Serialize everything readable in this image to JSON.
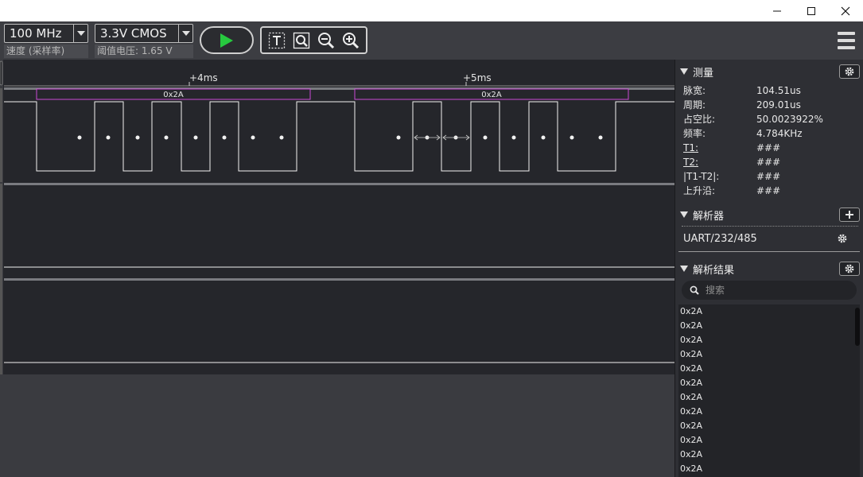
{
  "window": {
    "minimize": "—",
    "maximize": "☐",
    "close": "✕"
  },
  "toolbar": {
    "speed_value": "100 MHz",
    "speed_label": "速度 (采样率)",
    "voltage_value": "3.3V CMOS",
    "voltage_label": "阈值电压: 1.65 V",
    "run_icon": "play-icon",
    "tools": [
      "text-cursor-icon",
      "zoom-fit-icon",
      "zoom-out-icon",
      "zoom-in-icon"
    ],
    "menu_icon": "hamburger-menu-icon"
  },
  "waveform": {
    "time_markers": [
      {
        "label": "+4ms"
      },
      {
        "label": "+5ms"
      }
    ],
    "frames": [
      {
        "label": "0x2A"
      },
      {
        "label": "0x2A"
      }
    ],
    "colors": {
      "signal": "#f2f2f2",
      "frame_border": "#c94bd6",
      "background": "#25262b"
    }
  },
  "panel": {
    "measure_title": "测量",
    "measurements": [
      {
        "key": "脉宽:",
        "value": "104.51us"
      },
      {
        "key": "周期:",
        "value": "209.01us"
      },
      {
        "key": "占空比:",
        "value": "50.0023922%"
      },
      {
        "key": "频率:",
        "value": "4.784KHz"
      },
      {
        "key": "T1:",
        "value": "###"
      },
      {
        "key": "T2:",
        "value": "###"
      },
      {
        "key": "|T1-T2|:",
        "value": "###"
      },
      {
        "key": "上升沿:",
        "value": "###"
      }
    ],
    "decoder_title": "解析器",
    "decoder_name": "UART/232/485",
    "results_title": "解析结果",
    "search_placeholder": "搜索",
    "results": [
      "0x2A",
      "0x2A",
      "0x2A",
      "0x2A",
      "0x2A",
      "0x2A",
      "0x2A",
      "0x2A",
      "0x2A",
      "0x2A",
      "0x2A",
      "0x2A"
    ]
  }
}
